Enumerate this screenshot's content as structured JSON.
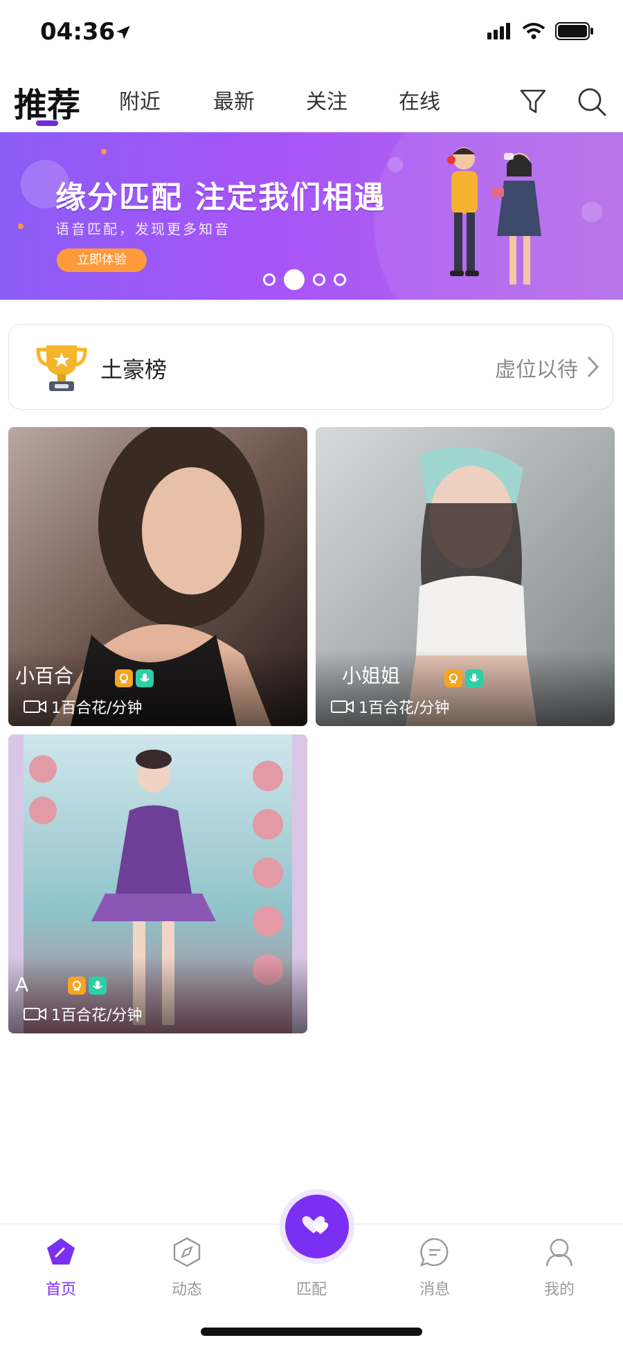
{
  "status": {
    "time": "04:36"
  },
  "tabs": [
    {
      "label": "推荐",
      "active": true
    },
    {
      "label": "附近"
    },
    {
      "label": "最新"
    },
    {
      "label": "关注"
    },
    {
      "label": "在线"
    }
  ],
  "banner": {
    "title": "缘分匹配 注定我们相遇",
    "subtitle": "语音匹配，发现更多知音",
    "button": "立即体验",
    "slides": 4,
    "active_slide": 2
  },
  "rank": {
    "title": "土豪榜",
    "right_text": "虚位以待"
  },
  "cards": [
    {
      "name": "小百合",
      "price": "1百合花/分钟"
    },
    {
      "name": "小姐姐",
      "price": "1百合花/分钟"
    },
    {
      "name": "A",
      "price": "1百合花/分钟"
    }
  ],
  "nav": {
    "home": "首页",
    "feed": "动态",
    "match": "匹配",
    "messages": "消息",
    "mine": "我的"
  },
  "colors": {
    "accent": "#7b2ff2",
    "banner_start": "#8b5cf6",
    "banner_end": "#b46be8",
    "banner_button": "#ff9a3c",
    "badge_video": "#f5a524",
    "badge_voice": "#2ecfa6"
  }
}
